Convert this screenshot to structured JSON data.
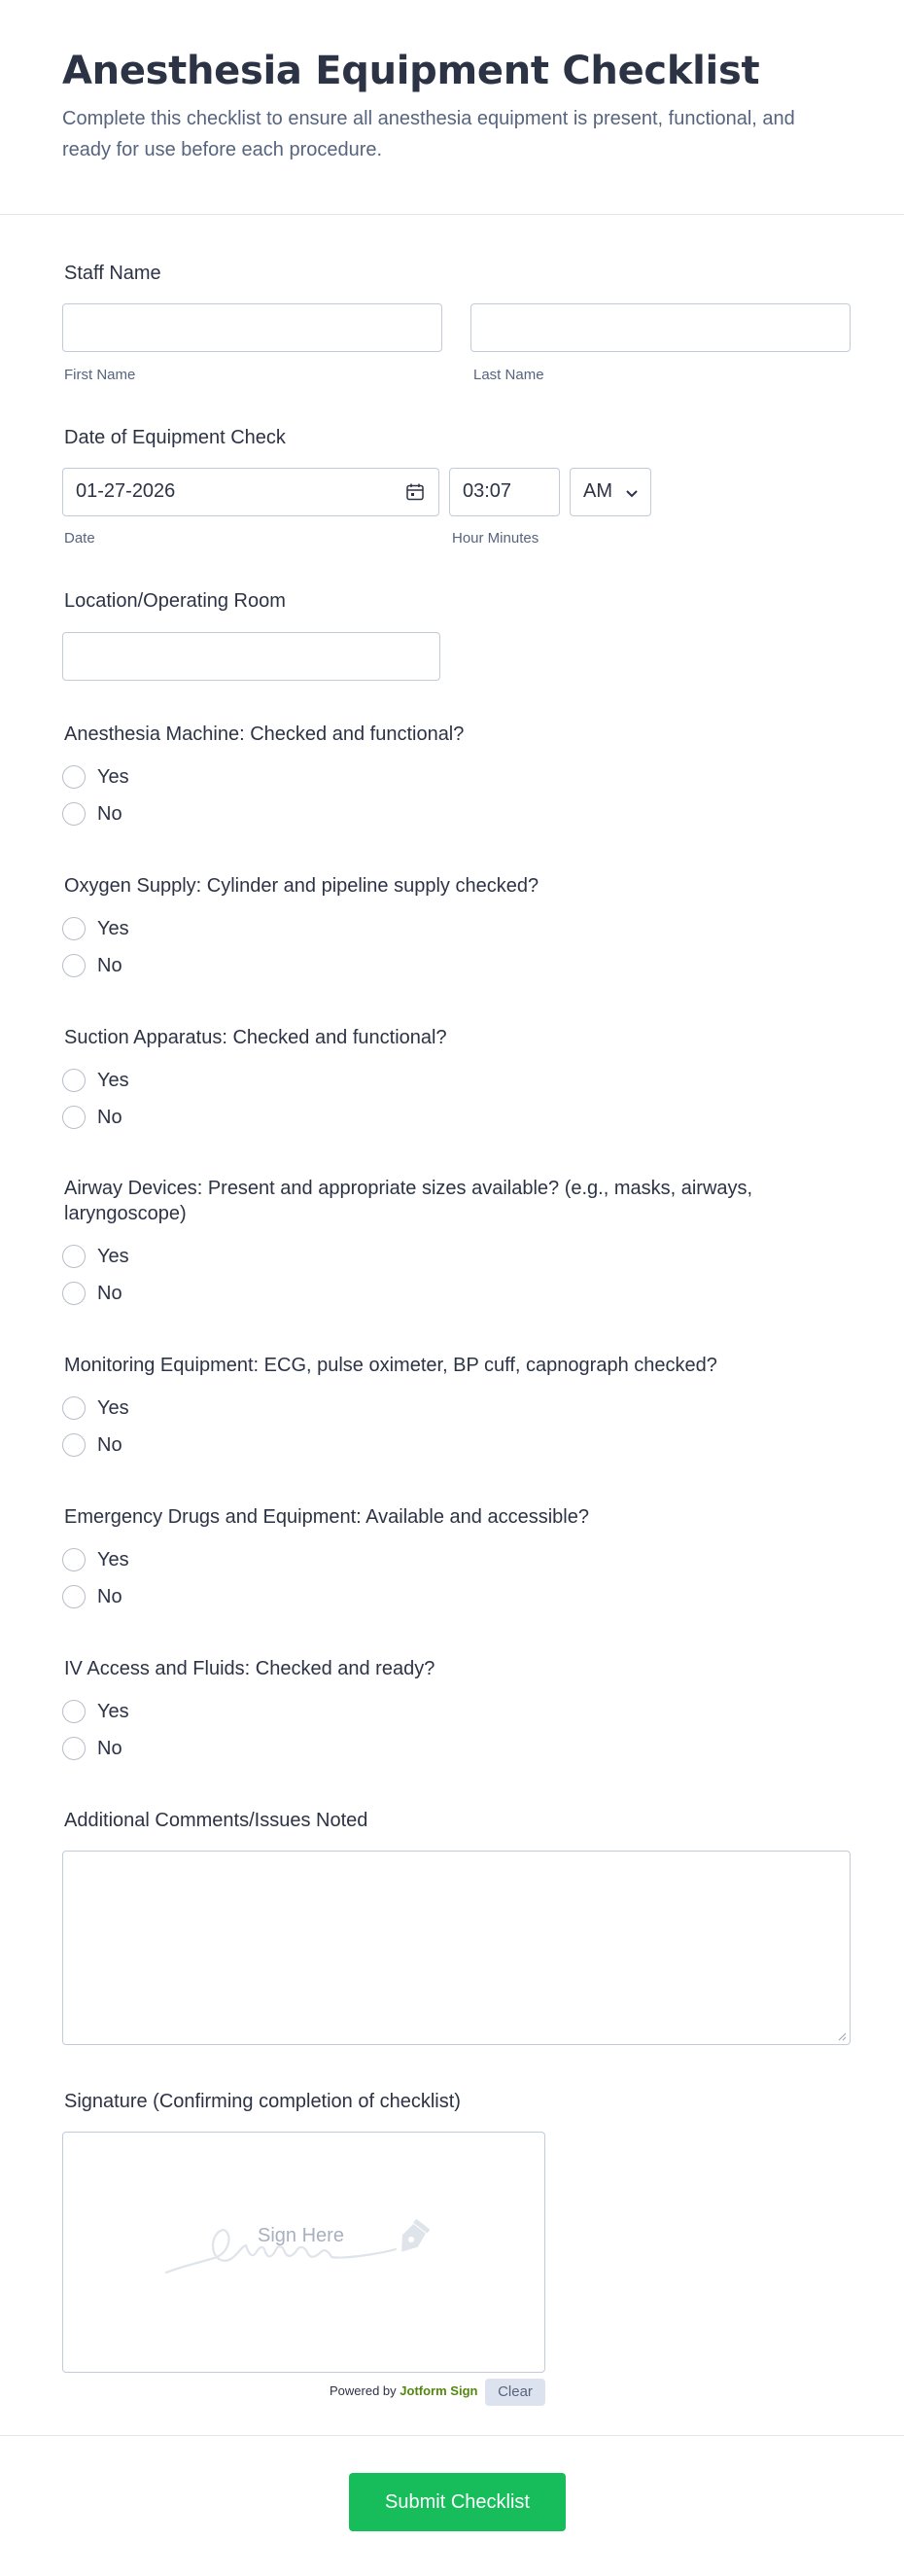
{
  "form": {
    "title": "Anesthesia Equipment Checklist",
    "description": "Complete this checklist to ensure all anesthesia equipment is present, functional, and ready for use before each procedure."
  },
  "staff_name": {
    "label": "Staff Name",
    "first_label": "First Name",
    "last_label": "Last Name",
    "first_value": "",
    "last_value": ""
  },
  "date_check": {
    "label": "Date of Equipment Check",
    "date_value": "01-27-2026",
    "date_sublabel": "Date",
    "time_value": "03:07",
    "ampm_value": "AM",
    "time_sublabel": "Hour Minutes"
  },
  "location": {
    "label": "Location/Operating Room",
    "value": ""
  },
  "questions": [
    {
      "label": "Anesthesia Machine: Checked and functional?",
      "yes": "Yes",
      "no": "No"
    },
    {
      "label": "Oxygen Supply: Cylinder and pipeline supply checked?",
      "yes": "Yes",
      "no": "No"
    },
    {
      "label": "Suction Apparatus: Checked and functional?",
      "yes": "Yes",
      "no": "No"
    },
    {
      "label_line1": "Airway Devices: Present and appropriate sizes available? (e.g., masks, airways,",
      "label_line2": "laryngoscope)",
      "yes": "Yes",
      "no": "No"
    },
    {
      "label": "Monitoring Equipment: ECG, pulse oximeter, BP cuff, capnograph checked?",
      "yes": "Yes",
      "no": "No"
    },
    {
      "label": "Emergency Drugs and Equipment: Available and accessible?",
      "yes": "Yes",
      "no": "No"
    },
    {
      "label": "IV Access and Fluids: Checked and ready?",
      "yes": "Yes",
      "no": "No"
    }
  ],
  "comments": {
    "label": "Additional Comments/Issues Noted",
    "value": ""
  },
  "signature": {
    "label": "Signature (Confirming completion of checklist)",
    "placeholder": "Sign Here",
    "powered_by": "Powered by",
    "brand": "Jotform Sign",
    "clear_label": "Clear"
  },
  "submit_label": "Submit Checklist",
  "colors": {
    "submit": "#18bd5b",
    "heading": "#2c3345",
    "muted": "#57647e",
    "border": "#c3cad8"
  }
}
